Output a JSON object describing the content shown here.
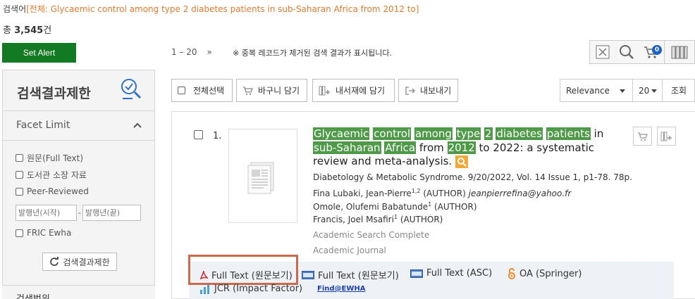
{
  "search": {
    "label": "검색어",
    "query": "[전체: Glycaemic control among type 2 diabetes patients in sub-Saharan Africa from 2012 to]"
  },
  "total": {
    "prefix": "총",
    "count": "3,545",
    "suffix": "건"
  },
  "alert_button": "Set Alert",
  "pager": {
    "range": "1 – 20",
    "next": "»"
  },
  "dedupe_note": "※ 중복 레코드가 제거된 검색 결과가 표시됩니다.",
  "toolbar": {
    "cart_count": "0",
    "icons": [
      "excel-icon",
      "search-icon",
      "cart-icon",
      "bookshelf-icon"
    ]
  },
  "sidebar": {
    "title": "검색결과제한",
    "facet_title": "Facet Limit",
    "facets": [
      "원문(Full Text)",
      "도서관 소장 자료",
      "Peer-Reviewed"
    ],
    "year_start_placeholder": "발행년(시작)",
    "year_end_placeholder": "발행년(끝)",
    "year_sep": "-",
    "fric_label": "FRIC Ewha",
    "limit_button": "검색결과제한",
    "next_section": "검색범위"
  },
  "actions": {
    "select_all": "전체선택",
    "cart": "바구니 담기",
    "bookshelf": "내서재에 담기",
    "export": "내보내기",
    "sort": "Relevance",
    "per_page": "20",
    "view": "조회"
  },
  "result": {
    "number": "1.",
    "title_parts": [
      {
        "t": "Glycaemic",
        "hl": true
      },
      {
        "t": " ",
        "hl": false
      },
      {
        "t": "control",
        "hl": true
      },
      {
        "t": " ",
        "hl": false
      },
      {
        "t": "among",
        "hl": true
      },
      {
        "t": " ",
        "hl": false
      },
      {
        "t": "type",
        "hl": true
      },
      {
        "t": " ",
        "hl": false
      },
      {
        "t": "2",
        "hl": true
      },
      {
        "t": " ",
        "hl": false
      },
      {
        "t": "diabetes",
        "hl": true
      },
      {
        "t": " ",
        "hl": false
      },
      {
        "t": "patients",
        "hl": true
      },
      {
        "t": " in ",
        "hl": false
      },
      {
        "t": "sub-Saharan",
        "hl": true
      },
      {
        "t": " ",
        "hl": false
      },
      {
        "t": "Africa",
        "hl": true
      },
      {
        "t": " from ",
        "hl": false
      },
      {
        "t": "2012",
        "hl": true
      },
      {
        "t": " to 2022: a systematic review and meta-analysis.",
        "hl": false
      }
    ],
    "source": "Diabetology & Metabolic Syndrome. 9/20/2022, Vol. 14 Issue 1, p1-78. 78p.",
    "authors": [
      {
        "name": "Fina Lubaki, Jean-Pierre",
        "sup": "1,2",
        "role": " (AUTHOR) ",
        "email": "jeanpierrefina@yahoo.fr"
      },
      {
        "name": "Omole, Olufemi Babatunde",
        "sup": "1",
        "role": " (AUTHOR)",
        "email": ""
      },
      {
        "name": "Francis, Joel Msafiri",
        "sup": "1",
        "role": " (AUTHOR)",
        "email": ""
      }
    ],
    "database": "Academic Search Complete",
    "doc_type": "Academic Journal",
    "links": {
      "pdf_full_text": "Full Text (원문보기)",
      "html_full_text": "Full Text (원문보기)",
      "asc_full_text": "Full Text (ASC)",
      "oa": "OA (Springer)",
      "jcr": "JCR (Impact Factor)",
      "find": "Find@EWHA"
    }
  },
  "colors": {
    "alert": "#137a24",
    "highlight": "#4e9a48",
    "query": "#e07a2c",
    "focus_box": "#c96a4c",
    "badge": "#1d62c3"
  }
}
